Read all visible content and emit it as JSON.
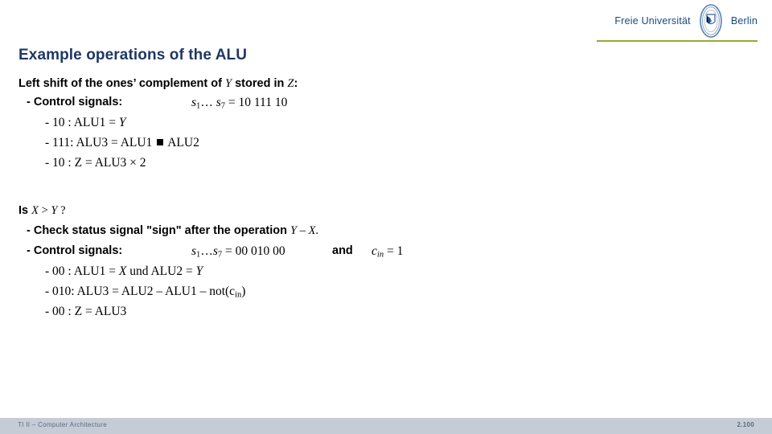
{
  "logo": {
    "left_word": "Freie Universität",
    "right_word": "Berlin",
    "seal_name": "fu-berlin-seal",
    "underline_color": "#9aa832",
    "text_color": "#1c4a7e"
  },
  "title": {
    "text": "Example operations of the ALU",
    "color": "#1f3864"
  },
  "block1": {
    "heading_pre": "Left shift of the ones’ complement of ",
    "heading_var1": "Y",
    "heading_mid": " stored in ",
    "heading_var2": "Z",
    "heading_post": ":",
    "control_label": "- Control signals:",
    "control_value_s": "s",
    "control_value_sub1": "1",
    "control_value_dots": "… ",
    "control_value_s2": "s",
    "control_value_sub7": "7",
    "control_value_eq": " = 10 111 10",
    "rows": [
      {
        "code": "- 10  : ALU1 = ",
        "var": "Y",
        "tail": ""
      },
      {
        "code": "- 111: ALU3 = ALU1 ",
        "var": "",
        "tail": " ALU2",
        "square": true
      },
      {
        "code": "- 10  : Z",
        "var": "",
        "tail": "    = ALU3 × 2",
        "italicZ": true
      }
    ]
  },
  "block2": {
    "heading_pre": "Is  ",
    "heading_var1": "X",
    "heading_gt": " > ",
    "heading_var2": "Y",
    "heading_post": " ?",
    "check_pre": "- Check status signal \"sign\" after the operation ",
    "check_var1": "Y",
    "check_minus": " – ",
    "check_var2": "X",
    "check_post": ".",
    "control_label": "- Control signals:",
    "control_value_s": "s",
    "control_value_sub1": "1",
    "control_value_dots": "…",
    "control_value_s2": "s",
    "control_value_sub7": "7",
    "control_value_eq": " = 00 010 00",
    "and_word": "and",
    "cin_c": "c",
    "cin_sub": "in",
    "cin_eq": " = 1",
    "rows": [
      {
        "code": "- 00  : ALU1 = ",
        "var1": "X",
        "mid": " und ALU2 = ",
        "var2": "Y"
      },
      {
        "code": "- 010: ALU3 = ALU2 – ALU1 – not(c",
        "sub": "in",
        "tail": ")"
      },
      {
        "code": "- 00  : Z",
        "tail": "      = ALU3"
      }
    ]
  },
  "footer": {
    "left_text": "TI II – Computer Architecture",
    "page_number": "2.100",
    "bar_color": "#c6ccd6",
    "text_color": "#5a6a80"
  }
}
